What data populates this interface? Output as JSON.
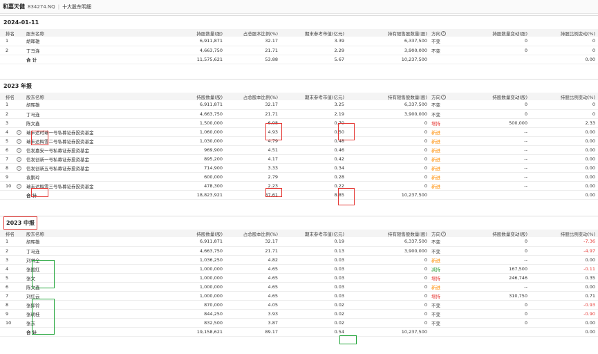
{
  "header": {
    "company": "和嘉天健",
    "code": "834274.NQ",
    "subtitle": "十大股东明细"
  },
  "columns": [
    "排名",
    "股东名称",
    "持股数量(股)",
    "占总股本比例(%)",
    "期末参考市值(亿元)",
    "持有限售股数量(股)",
    "方向",
    "持股数量变动(股)",
    "持股比例变动(%)"
  ],
  "sections": [
    {
      "title": "2024-01-11",
      "rows": [
        {
          "rank": "1",
          "name": "胡晖雄",
          "shares": "6,911,871",
          "pct": "32.17",
          "mv": "3.39",
          "limited": "6,337,500",
          "dir": "不变",
          "dir_color": "plain",
          "chg": "0",
          "chp": "0"
        },
        {
          "rank": "2",
          "name": "丁马连",
          "shares": "4,663,750",
          "pct": "21.71",
          "mv": "2.29",
          "limited": "3,900,000",
          "dir": "不变",
          "dir_color": "plain",
          "chg": "0",
          "chp": "0"
        }
      ],
      "total": {
        "label": "合 计",
        "shares": "11,575,621",
        "pct": "53.88",
        "mv": "5.67",
        "limited": "10,237,500",
        "chg": "",
        "chp": "0.00"
      }
    },
    {
      "title": "2023 年报",
      "rows": [
        {
          "rank": "1",
          "name": "胡晖雄",
          "shares": "6,911,871",
          "pct": "32.17",
          "mv": "3.25",
          "limited": "6,337,500",
          "dir": "不变",
          "dir_color": "plain",
          "chg": "0",
          "chp": "0"
        },
        {
          "rank": "2",
          "name": "丁马连",
          "shares": "4,663,750",
          "pct": "21.71",
          "mv": "2.19",
          "limited": "3,900,000",
          "dir": "不变",
          "dir_color": "plain",
          "chg": "0",
          "chp": "0"
        },
        {
          "rank": "3",
          "name": "陈文鑫",
          "shares": "1,500,000",
          "pct": "6.98",
          "mv": "0.70",
          "limited": "0",
          "dir": "增持",
          "dir_color": "red",
          "chg": "500,000",
          "chp": "2.33"
        },
        {
          "rank": "4",
          "name": "瑞丰达时瑞一号私募证券投资基金",
          "shares": "1,060,000",
          "pct": "4.93",
          "mv": "0.50",
          "limited": "0",
          "dir": "新进",
          "dir_color": "orange",
          "chg": "--",
          "chp": "0.00",
          "icon": true
        },
        {
          "rank": "5",
          "name": "瑞丰达梅雪二号私募证券投资基金",
          "shares": "1,030,000",
          "pct": "4.79",
          "mv": "0.48",
          "limited": "0",
          "dir": "新进",
          "dir_color": "orange",
          "chg": "--",
          "chp": "0.00",
          "icon": true
        },
        {
          "rank": "6",
          "name": "信发嘉安一号私募证券投资基金",
          "shares": "969,900",
          "pct": "4.51",
          "mv": "0.46",
          "limited": "0",
          "dir": "新进",
          "dir_color": "orange",
          "chg": "--",
          "chp": "0.00",
          "icon": true
        },
        {
          "rank": "7",
          "name": "信发创新一号私募证券投资基金",
          "shares": "895,200",
          "pct": "4.17",
          "mv": "0.42",
          "limited": "0",
          "dir": "新进",
          "dir_color": "orange",
          "chg": "--",
          "chp": "0.00",
          "icon": true
        },
        {
          "rank": "8",
          "name": "信发创新五号私募证券投资基金",
          "shares": "714,900",
          "pct": "3.33",
          "mv": "0.34",
          "limited": "0",
          "dir": "新进",
          "dir_color": "orange",
          "chg": "--",
          "chp": "0.00",
          "icon": true
        },
        {
          "rank": "9",
          "name": "袁鹏玲",
          "shares": "600,000",
          "pct": "2.79",
          "mv": "0.28",
          "limited": "0",
          "dir": "新进",
          "dir_color": "orange",
          "chg": "--",
          "chp": "0.00"
        },
        {
          "rank": "10",
          "name": "瑞丰达梅雪三号私募证券投资基金",
          "shares": "478,300",
          "pct": "2.23",
          "mv": "0.22",
          "limited": "0",
          "dir": "新进",
          "dir_color": "orange",
          "chg": "--",
          "chp": "0.00",
          "icon": true
        }
      ],
      "total": {
        "label": "合 计",
        "shares": "18,823,921",
        "pct": "87.61",
        "mv": "8.85",
        "limited": "10,237,500",
        "chg": "",
        "chp": "0.00"
      }
    },
    {
      "title": "2023 中报",
      "rows": [
        {
          "rank": "1",
          "name": "胡晖雄",
          "shares": "6,911,871",
          "pct": "32.17",
          "mv": "0.19",
          "limited": "6,337,500",
          "dir": "不变",
          "dir_color": "plain",
          "chg": "0",
          "chp": "-7.36"
        },
        {
          "rank": "2",
          "name": "丁马连",
          "shares": "4,663,750",
          "pct": "21.71",
          "mv": "0.13",
          "limited": "3,900,000",
          "dir": "不变",
          "dir_color": "plain",
          "chg": "0",
          "chp": "-4.97"
        },
        {
          "rank": "3",
          "name": "刘林全",
          "shares": "1,036,250",
          "pct": "4.82",
          "mv": "0.03",
          "limited": "0",
          "dir": "新进",
          "dir_color": "orange",
          "chg": "--",
          "chp": "0.00"
        },
        {
          "rank": "4",
          "name": "张国红",
          "shares": "1,000,000",
          "pct": "4.65",
          "mv": "0.03",
          "limited": "0",
          "dir": "减持",
          "dir_color": "green",
          "chg": "167,500",
          "chp": "-0.11"
        },
        {
          "rank": "5",
          "name": "张文",
          "shares": "1,000,000",
          "pct": "4.65",
          "mv": "0.03",
          "limited": "0",
          "dir": "增持",
          "dir_color": "red",
          "chg": "246,746",
          "chp": "0.35"
        },
        {
          "rank": "6",
          "name": "陈文鑫",
          "shares": "1,000,000",
          "pct": "4.65",
          "mv": "0.03",
          "limited": "0",
          "dir": "新进",
          "dir_color": "orange",
          "chg": "--",
          "chp": "0.00"
        },
        {
          "rank": "7",
          "name": "刘红云",
          "shares": "1,000,000",
          "pct": "4.65",
          "mv": "0.03",
          "limited": "0",
          "dir": "增持",
          "dir_color": "red",
          "chg": "310,750",
          "chp": "0.71"
        },
        {
          "rank": "8",
          "name": "张抑铃",
          "shares": "870,000",
          "pct": "4.05",
          "mv": "0.02",
          "limited": "0",
          "dir": "不变",
          "dir_color": "plain",
          "chg": "0",
          "chp": "-0.93"
        },
        {
          "rank": "9",
          "name": "张朝桂",
          "shares": "844,250",
          "pct": "3.93",
          "mv": "0.02",
          "limited": "0",
          "dir": "不变",
          "dir_color": "plain",
          "chg": "0",
          "chp": "-0.90"
        },
        {
          "rank": "10",
          "name": "张东",
          "shares": "832,500",
          "pct": "3.87",
          "mv": "0.02",
          "limited": "0",
          "dir": "不变",
          "dir_color": "plain",
          "chg": "0",
          "chp": "0.00"
        }
      ],
      "total": {
        "label": "合 计",
        "shares": "19,158,621",
        "pct": "89.17",
        "mv": "0.54",
        "limited": "10,237,500",
        "chg": "",
        "chp": "0.00"
      }
    }
  ]
}
